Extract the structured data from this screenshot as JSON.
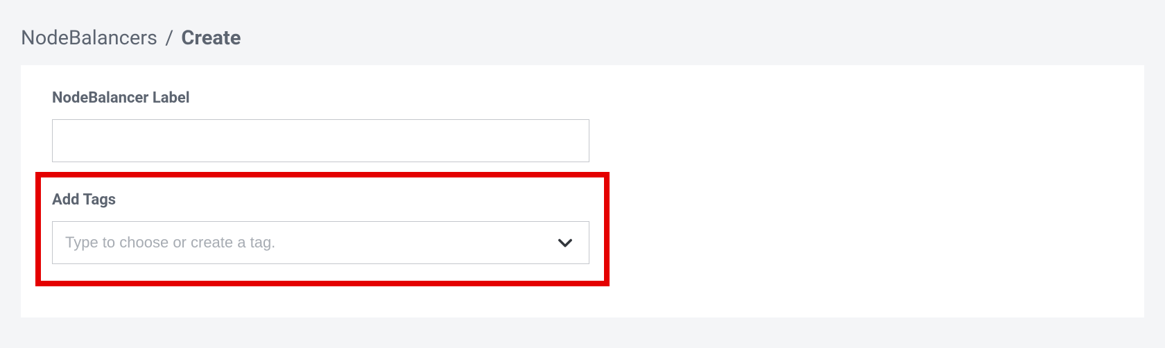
{
  "breadcrumb": {
    "parent": "NodeBalancers",
    "separator": "/",
    "current": "Create"
  },
  "form": {
    "label_field": {
      "label": "NodeBalancer Label",
      "value": ""
    },
    "tags_field": {
      "label": "Add Tags",
      "placeholder": "Type to choose or create a tag.",
      "value": ""
    }
  }
}
